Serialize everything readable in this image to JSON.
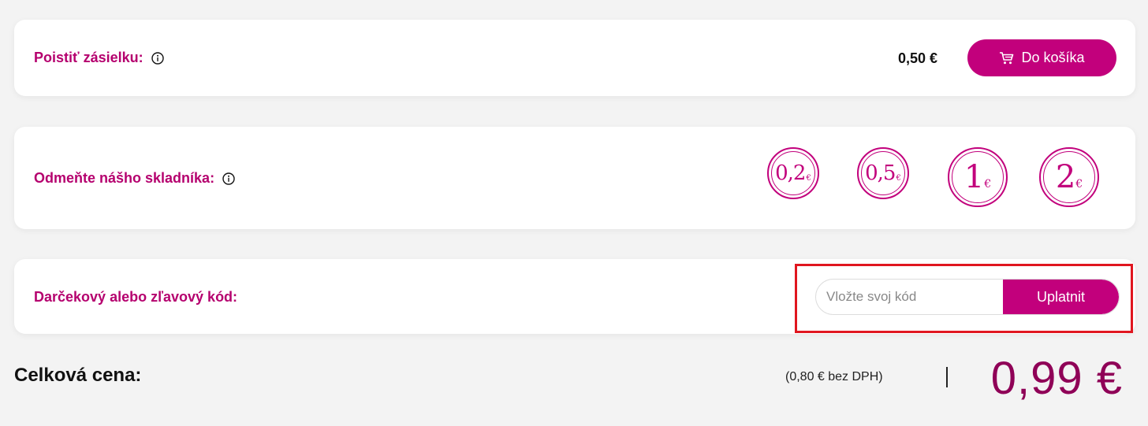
{
  "insurance": {
    "label": "Poistiť zásielku:",
    "price": "0,50 €",
    "button_label": "Do košíka"
  },
  "tip": {
    "label": "Odmeňte nášho skladníka:",
    "coins": [
      {
        "value": "0,2",
        "currency": "€"
      },
      {
        "value": "0,5",
        "currency": "€"
      },
      {
        "value": "1",
        "currency": "€"
      },
      {
        "value": "2",
        "currency": "€"
      }
    ]
  },
  "code": {
    "label": "Darčekový alebo zľavový kód:",
    "placeholder": "Vložte svoj kód",
    "button_label": "Uplatnit"
  },
  "total": {
    "label": "Celková cena:",
    "net": "(0,80 € bez DPH)",
    "price": "0,99 €"
  },
  "colors": {
    "accent": "#c2007c",
    "total_price": "#8f0057",
    "highlight": "#e0161f"
  }
}
